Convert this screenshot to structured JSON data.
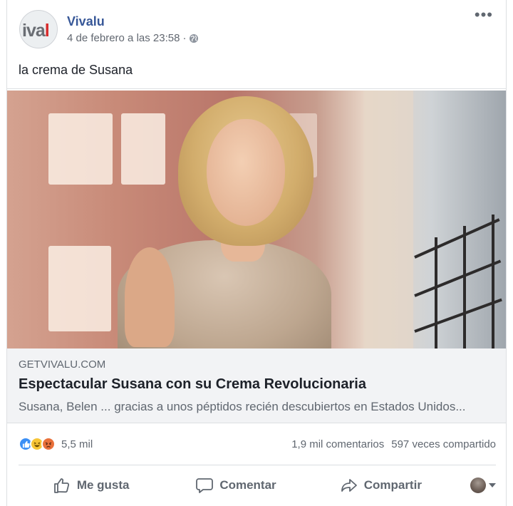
{
  "post": {
    "page_name": "Vivalu",
    "avatar_logo": {
      "left": "ival",
      "accent": "l"
    },
    "timestamp": "4 de febrero a las 23:58",
    "separator": "·",
    "privacy_icon": "globe-icon",
    "more_icon": "•••",
    "text": "la crema de Susana"
  },
  "link": {
    "domain": "GETVIVALU.COM",
    "title": "Espectacular Susana con su Crema Revolucionaria",
    "description": "Susana, Belen ... gracias a unos péptidos recién descubiertos en Estados Unidos..."
  },
  "reactions": {
    "icons": [
      "like-reaction-icon",
      "haha-reaction-icon",
      "angry-reaction-icon"
    ],
    "count": "5,5 mil",
    "comments": "1,9 mil comentarios",
    "shares": "597 veces compartido"
  },
  "actions": {
    "like": "Me gusta",
    "comment": "Comentar",
    "share": "Compartir"
  },
  "colors": {
    "link_blue": "#385898",
    "meta_gray": "#606770",
    "like_blue": "#3b8ff5"
  }
}
